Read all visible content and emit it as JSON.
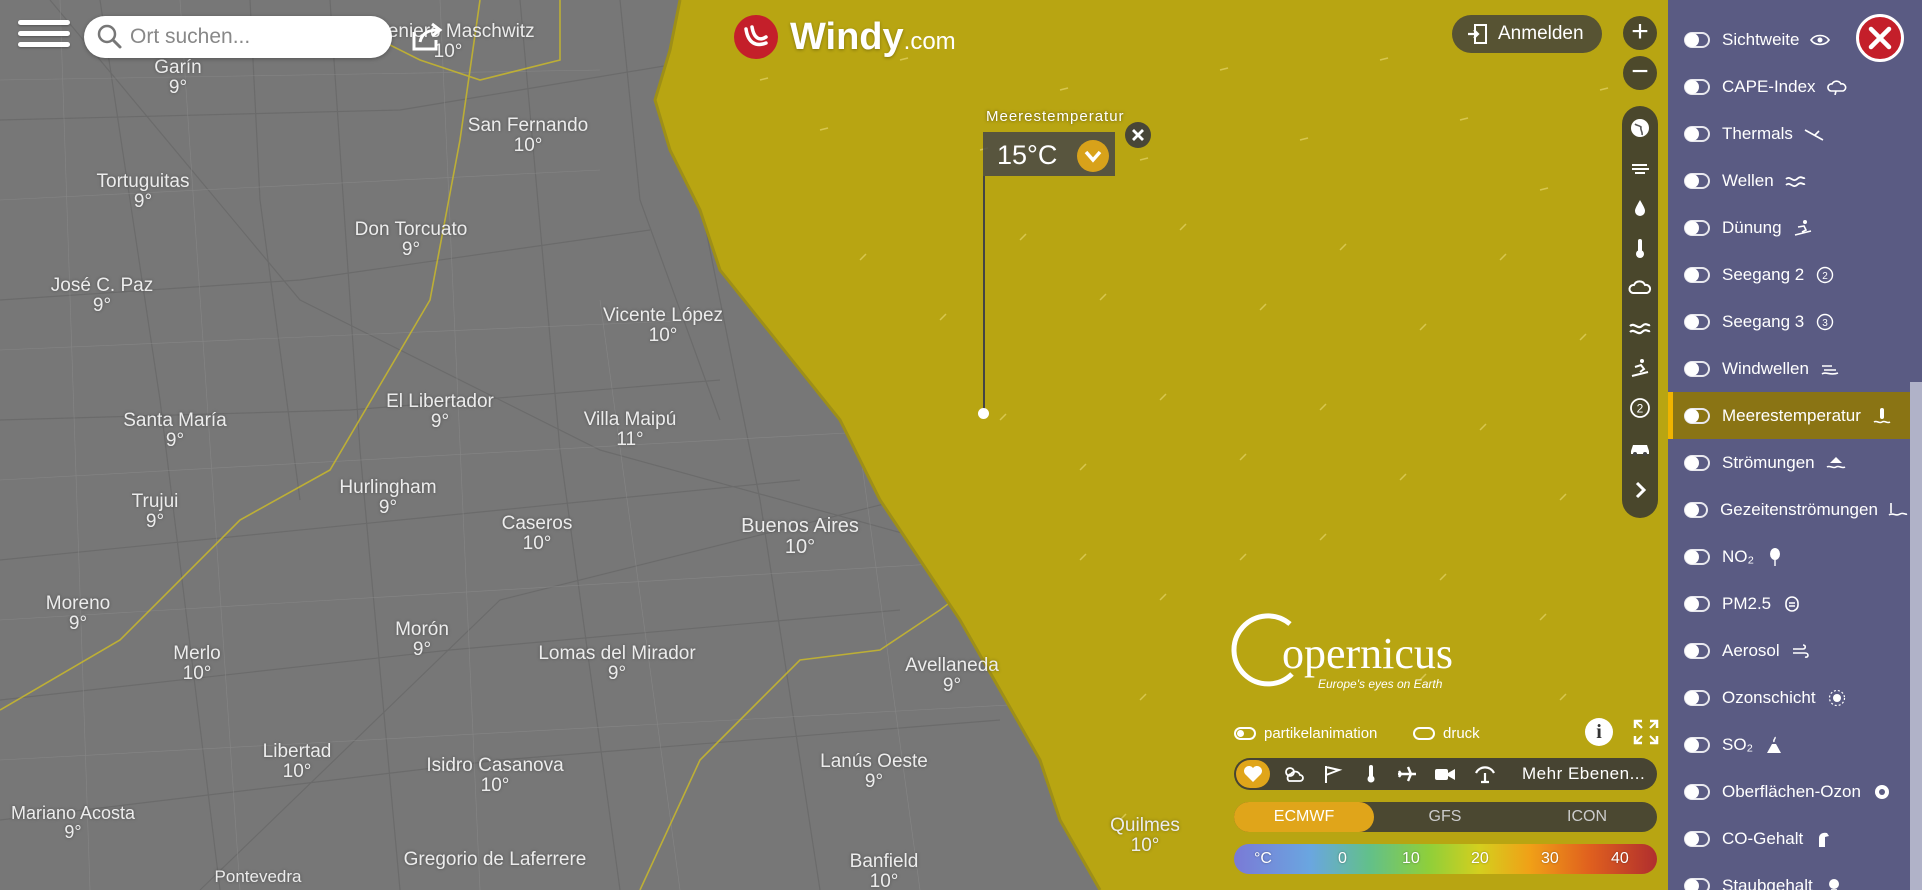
{
  "search": {
    "placeholder": "Ort suchen..."
  },
  "logo": {
    "main": "Windy",
    "suffix": ".com"
  },
  "login_label": "Anmelden",
  "zoom": {
    "in": "+",
    "out": "−"
  },
  "picker": {
    "title": "Meerestemperatur",
    "value": "15°C"
  },
  "cities": [
    {
      "name": "Garín",
      "temp": "9°"
    },
    {
      "name": "Ingeniero Maschwitz",
      "temp": "10°"
    },
    {
      "name": "San Fernando",
      "temp": "10°"
    },
    {
      "name": "Tortuguitas",
      "temp": "9°"
    },
    {
      "name": "Don Torcuato",
      "temp": "9°"
    },
    {
      "name": "José C. Paz",
      "temp": "9°"
    },
    {
      "name": "Vicente López",
      "temp": "10°"
    },
    {
      "name": "El Libertador",
      "temp": "9°"
    },
    {
      "name": "Villa Maipú",
      "temp": "11°"
    },
    {
      "name": "Santa María",
      "temp": "9°"
    },
    {
      "name": "Hurlingham",
      "temp": "9°"
    },
    {
      "name": "Trujui",
      "temp": "9°"
    },
    {
      "name": "Caseros",
      "temp": "10°"
    },
    {
      "name": "Buenos Aires",
      "temp": "10°"
    },
    {
      "name": "Moreno",
      "temp": "9°"
    },
    {
      "name": "Merlo",
      "temp": "10°"
    },
    {
      "name": "Morón",
      "temp": "9°"
    },
    {
      "name": "Lomas del Mirador",
      "temp": "9°"
    },
    {
      "name": "Avellaneda",
      "temp": "9°"
    },
    {
      "name": "Libertad",
      "temp": "10°"
    },
    {
      "name": "Isidro Casanova",
      "temp": "10°"
    },
    {
      "name": "Lanús Oeste",
      "temp": "9°"
    },
    {
      "name": "Mariano Acosta",
      "temp": "9°"
    },
    {
      "name": "Quilmes",
      "temp": "10°"
    },
    {
      "name": "Gregorio de Laferrere",
      "temp": ""
    },
    {
      "name": "Banfield",
      "temp": "10°"
    },
    {
      "name": "Pontevedra",
      "temp": ""
    }
  ],
  "copernicus": {
    "name": "opernicus",
    "tagline": "Europe's eyes on Earth"
  },
  "options": {
    "particles": "partikelanimation",
    "pressure": "druck"
  },
  "toolbar": {
    "more_layers": "Mehr Ebenen..."
  },
  "models": [
    "ECMWF",
    "GFS",
    "ICON"
  ],
  "legend": {
    "unit": "°C",
    "ticks": [
      "0",
      "10",
      "20",
      "30",
      "40"
    ]
  },
  "colors": {
    "sea": "#b8a512",
    "accent": "#e0a51a",
    "panel": "#5a5b83",
    "active_item": "#8a7414"
  },
  "layers": [
    {
      "label": "Sichtweite",
      "icon": "eye-icon"
    },
    {
      "label": "CAPE-Index",
      "icon": "cloud-icon"
    },
    {
      "label": "Thermals",
      "icon": "glider-icon"
    },
    {
      "label": "Wellen",
      "icon": "waves-icon"
    },
    {
      "label": "Dünung",
      "icon": "surfer-icon"
    },
    {
      "label": "Seegang 2",
      "icon": "circle-2-icon"
    },
    {
      "label": "Seegang 3",
      "icon": "circle-3-icon"
    },
    {
      "label": "Windwellen",
      "icon": "wind-waves-icon"
    },
    {
      "label": "Meerestemperatur",
      "icon": "sea-temp-icon",
      "active": true
    },
    {
      "label": "Strömungen",
      "icon": "currents-icon"
    },
    {
      "label": "Gezeitenströmungen",
      "icon": "tide-icon"
    },
    {
      "label": "NO₂",
      "icon": "balloon-icon"
    },
    {
      "label": "PM2.5",
      "icon": "particle-icon"
    },
    {
      "label": "Aerosol",
      "icon": "aerosol-icon"
    },
    {
      "label": "Ozonschicht",
      "icon": "ozone-icon"
    },
    {
      "label": "SO₂",
      "icon": "volcano-icon"
    },
    {
      "label": "Oberflächen-Ozon",
      "icon": "surface-ozone-icon"
    },
    {
      "label": "CO-Gehalt",
      "icon": "co-icon"
    },
    {
      "label": "Staubgehalt",
      "icon": "dust-icon"
    }
  ]
}
